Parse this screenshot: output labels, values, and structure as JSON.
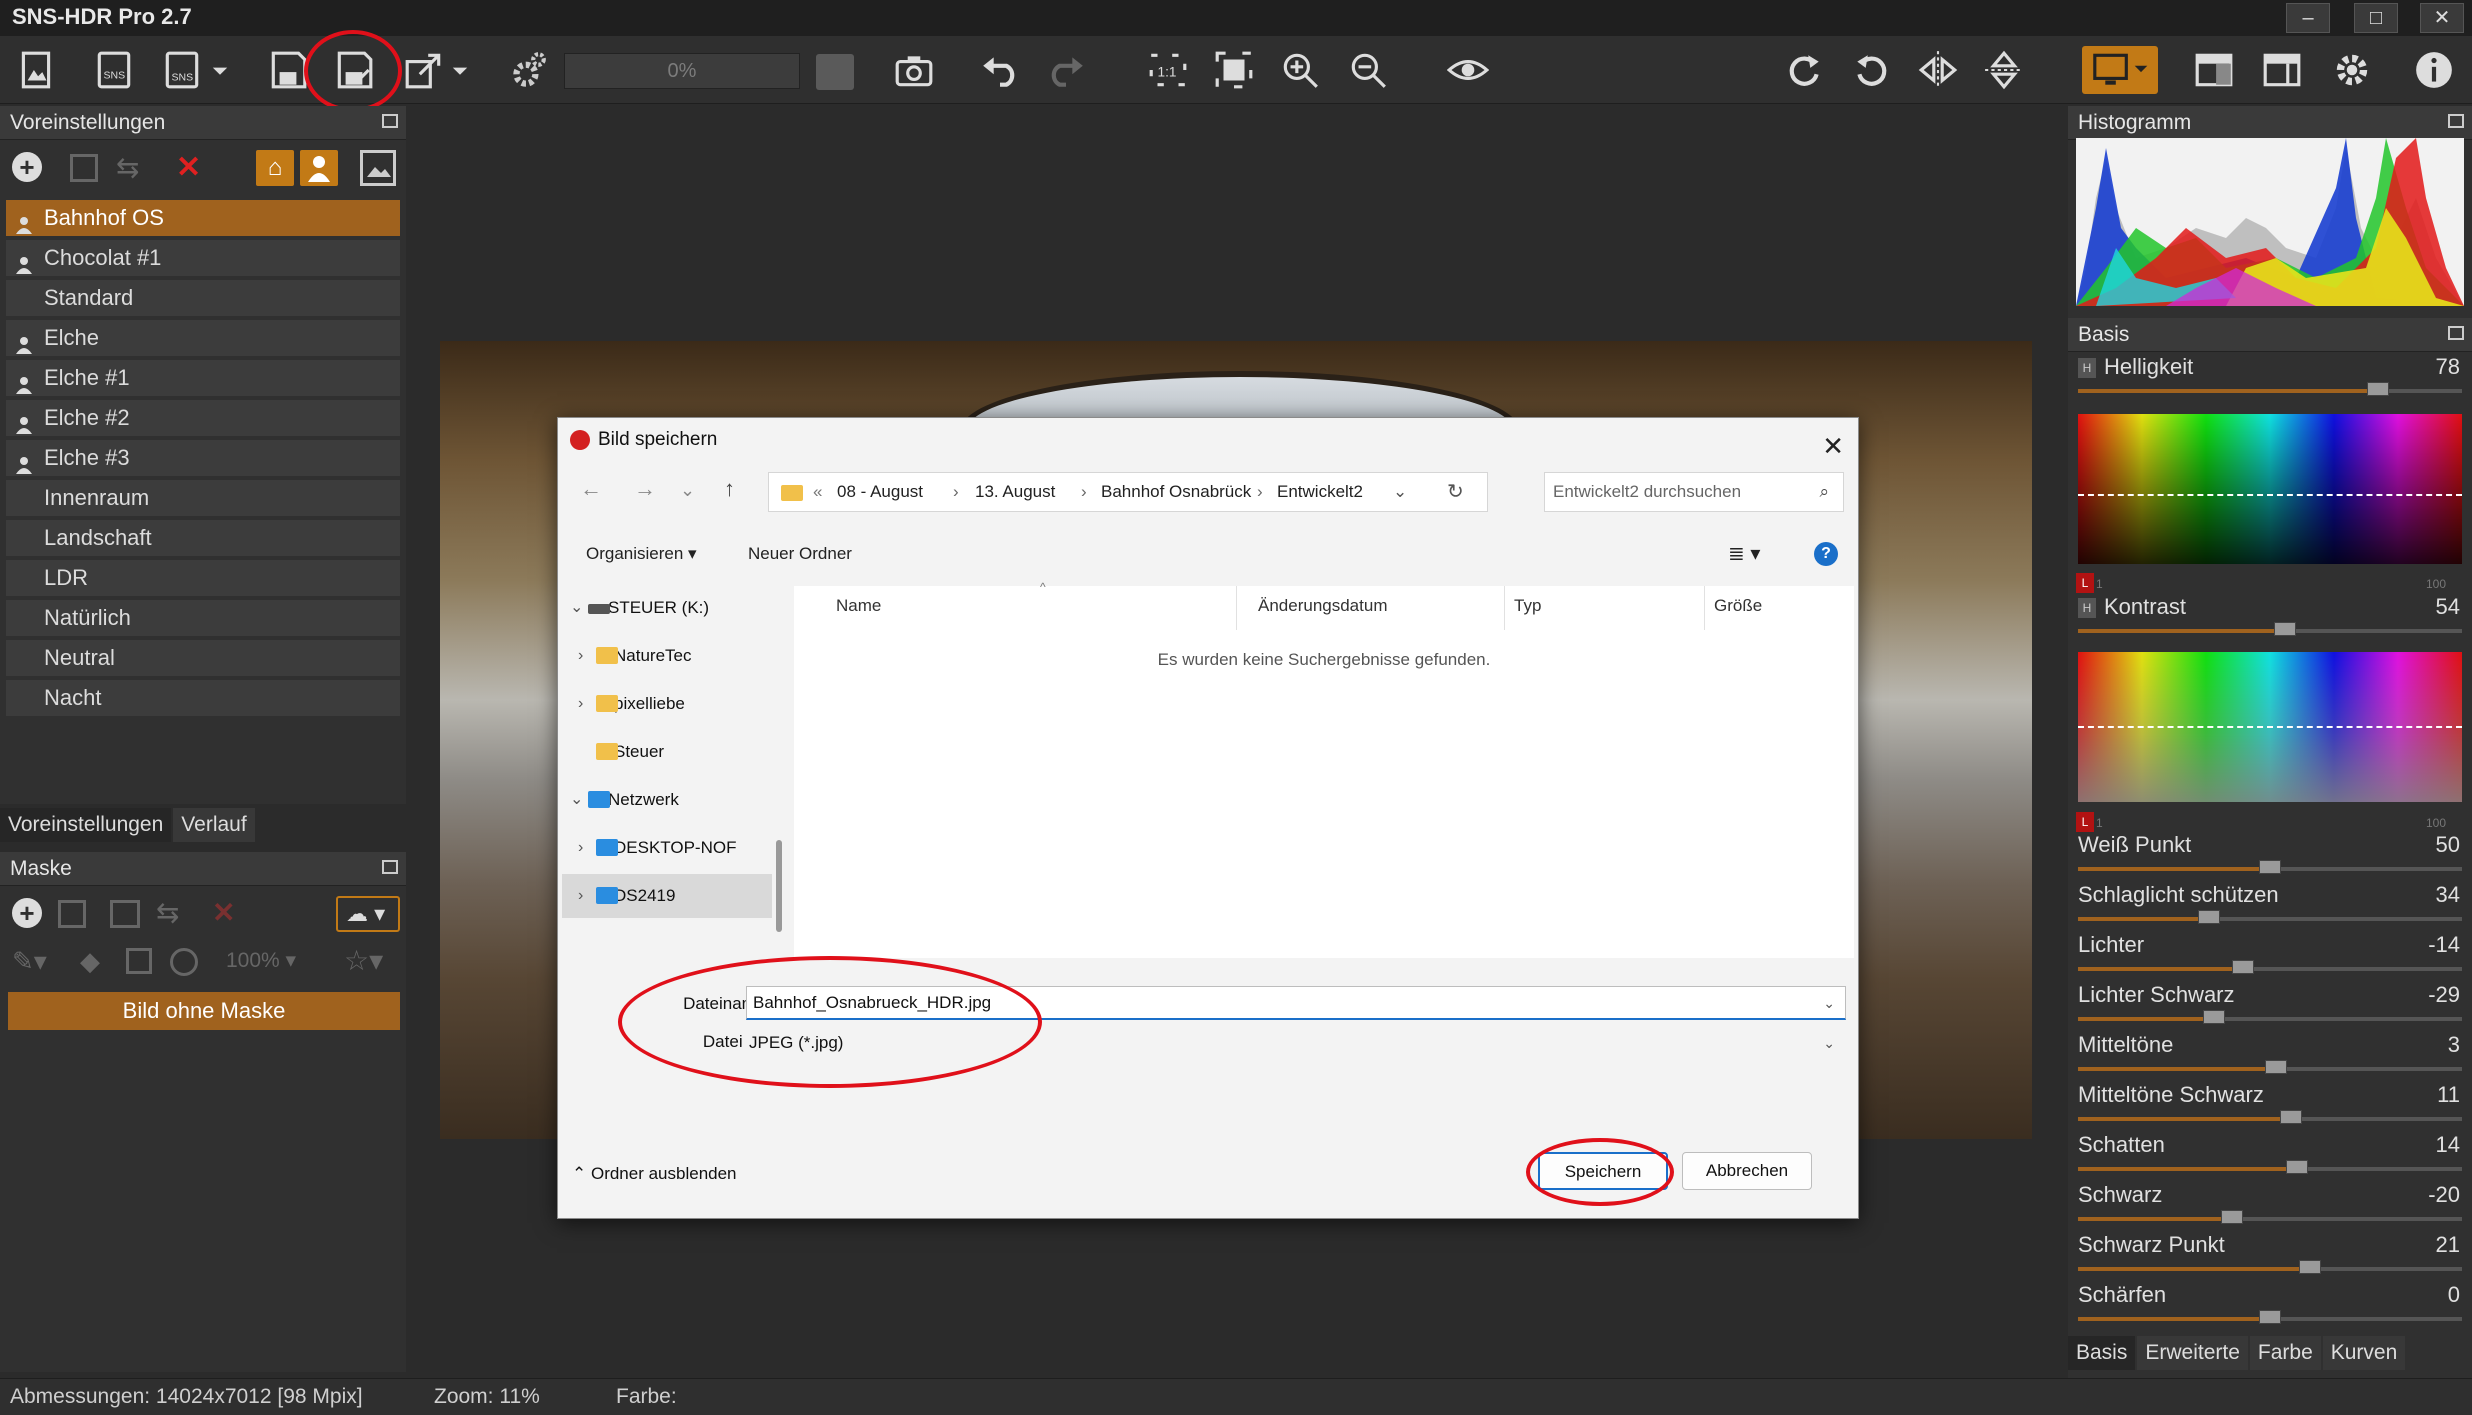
{
  "app": {
    "title": "SNS-HDR Pro 2.7"
  },
  "window_controls": {
    "minimize": "–",
    "maximize": "□",
    "close": "✕"
  },
  "toolbar": {
    "progress": "0%",
    "icons": [
      "open-image-icon",
      "open-sns-icon",
      "save-sns-icon",
      "save-icon",
      "save-as-icon",
      "export-icon",
      "batch-settings-icon",
      "camera-icon",
      "undo-icon",
      "redo-icon",
      "zoom-1to1-icon",
      "fit-screen-icon",
      "zoom-in-icon",
      "zoom-out-icon",
      "preview-eye-icon",
      "redo-rotate-icon",
      "rotate-ccw-icon",
      "flip-horizontal-icon",
      "flip-vertical-icon",
      "display-icon",
      "layout-1-icon",
      "layout-2-icon",
      "settings-gear-icon",
      "info-icon"
    ]
  },
  "presets_panel": {
    "title": "Voreinstellungen",
    "items": [
      {
        "label": "Bahnhof OS",
        "user": true,
        "selected": true
      },
      {
        "label": "Chocolat #1",
        "user": true
      },
      {
        "label": "Standard",
        "user": false
      },
      {
        "label": "Elche",
        "user": true
      },
      {
        "label": "Elche #1",
        "user": true
      },
      {
        "label": "Elche #2",
        "user": true
      },
      {
        "label": "Elche #3",
        "user": true
      },
      {
        "label": "Innenraum",
        "user": false
      },
      {
        "label": "Landschaft",
        "user": false
      },
      {
        "label": "LDR",
        "user": false
      },
      {
        "label": "Natürlich",
        "user": false
      },
      {
        "label": "Neutral",
        "user": false
      },
      {
        "label": "Nacht",
        "user": false
      }
    ],
    "tabs": [
      "Voreinstellungen",
      "Verlauf"
    ]
  },
  "mask_panel": {
    "title": "Maske",
    "zoom": "100%",
    "button": "Bild ohne Maske"
  },
  "save_dialog": {
    "title": "Bild speichern",
    "breadcrumb": [
      "«",
      "08 - August",
      "13. August",
      "Bahnhof Osnabrück",
      "Entwickelt2"
    ],
    "search_placeholder": "Entwickelt2 durchsuchen",
    "organize": "Organisieren",
    "new_folder": "Neuer Ordner",
    "tree": [
      {
        "label": "STEUER (K:)",
        "type": "drive",
        "expanded": true
      },
      {
        "label": "NatureTec",
        "type": "folder"
      },
      {
        "label": "pixelliebe",
        "type": "folder"
      },
      {
        "label": "Steuer",
        "type": "folder"
      },
      {
        "label": "Netzwerk",
        "type": "network",
        "expanded": true
      },
      {
        "label": "DESKTOP-NOF",
        "type": "pc"
      },
      {
        "label": "DS2419",
        "type": "pc",
        "selected": true
      }
    ],
    "columns": [
      "Name",
      "Änderungsdatum",
      "Typ",
      "Größe"
    ],
    "empty_message": "Es wurden keine Suchergebnisse gefunden.",
    "filename_label": "Dateiname:",
    "filename_value": "Bahnhof_Osnabrueck_HDR.jpg",
    "filetype_label": "Dateityp:",
    "filetype_value": "JPEG (*.jpg)",
    "hide_folders": "Ordner ausblenden",
    "save": "Speichern",
    "cancel": "Abbrechen"
  },
  "histogram_panel": {
    "title": "Histogramm"
  },
  "basis_panel": {
    "title": "Basis",
    "sliders": [
      {
        "label": "Helligkeit",
        "value": "78",
        "level": 0.78
      },
      {
        "label": "Kontrast",
        "value": "54",
        "level": 0.54
      },
      {
        "label": "Weiß Punkt",
        "value": "50",
        "level": 0.5
      },
      {
        "label": "Schlaglicht schützen",
        "value": "34",
        "level": 0.34
      },
      {
        "label": "Lichter",
        "value": "-14",
        "level": 0.43
      },
      {
        "label": "Lichter Schwarz",
        "value": "-29",
        "level": 0.355
      },
      {
        "label": "Mitteltöne",
        "value": "3",
        "level": 0.515
      },
      {
        "label": "Mitteltöne Schwarz",
        "value": "11",
        "level": 0.555
      },
      {
        "label": "Schatten",
        "value": "14",
        "level": 0.57
      },
      {
        "label": "Schwarz",
        "value": "-20",
        "level": 0.4
      },
      {
        "label": "Schwarz Punkt",
        "value": "21",
        "level": 0.605
      },
      {
        "label": "Schärfen",
        "value": "0",
        "level": 0.5
      }
    ],
    "scale_max": "100",
    "scale_min": "1",
    "tabs": [
      "Basis",
      "Erweiterte",
      "Farbe",
      "Kurven"
    ]
  },
  "status": {
    "dimensions": "Abmessungen: 14024x7012 [98 Mpix]",
    "zoom": "Zoom: 11%",
    "color": "Farbe:"
  },
  "colors": {
    "accent": "#a0621e",
    "highlight_ring": "#e0101a"
  }
}
